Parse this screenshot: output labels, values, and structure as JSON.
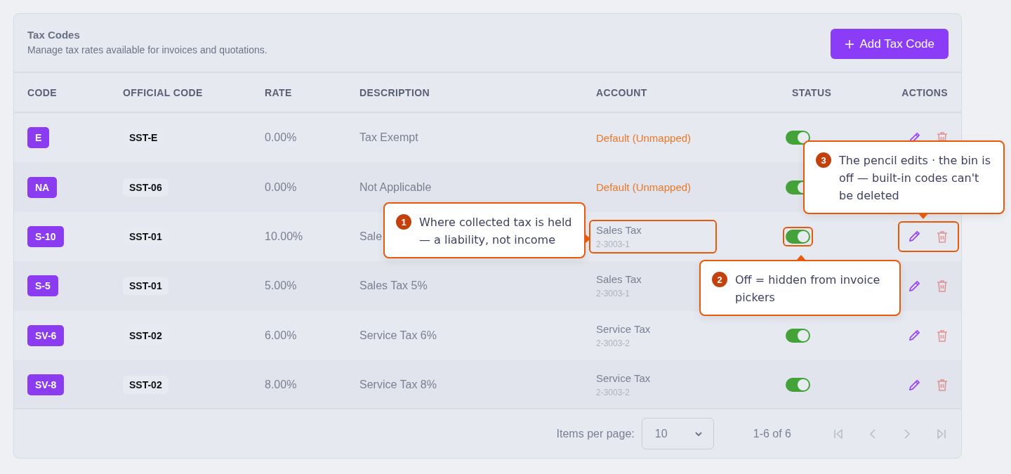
{
  "header": {
    "title": "Tax Codes",
    "subtitle": "Manage tax rates available for invoices and quotations.",
    "add_button": "Add Tax Code"
  },
  "table": {
    "columns": [
      "CODE",
      "OFFICIAL CODE",
      "RATE",
      "DESCRIPTION",
      "ACCOUNT",
      "STATUS",
      "ACTIONS"
    ],
    "rows": [
      {
        "code": "E",
        "official_code": "SST-E",
        "rate": "0.00%",
        "description": "Tax Exempt",
        "account": {
          "kind": "default",
          "name": "Default (Unmapped)",
          "highlighted": false
        },
        "status": {
          "on": true,
          "highlighted": false
        },
        "actions": {
          "highlighted": false,
          "items": [
            {
              "kind": "edit",
              "disabled": false
            },
            {
              "kind": "delete",
              "disabled": true
            }
          ]
        }
      },
      {
        "code": "NA",
        "official_code": "SST-06",
        "rate": "0.00%",
        "description": "Not Applicable",
        "account": {
          "kind": "default",
          "name": "Default (Unmapped)",
          "highlighted": false
        },
        "status": {
          "on": true,
          "highlighted": false
        }
      },
      {
        "code": "S-10",
        "official_code": "SST-01",
        "rate": "10.00%",
        "description": "Sale",
        "account": {
          "kind": "mapped",
          "name": "Sales Tax",
          "number": "2-3003-1",
          "highlighted": true
        },
        "status": {
          "on": true,
          "highlighted": true
        },
        "actions": {
          "highlighted": true,
          "items": [
            {
              "kind": "edit",
              "disabled": false
            },
            {
              "kind": "delete",
              "disabled": true
            }
          ]
        }
      },
      {
        "code": "S-5",
        "official_code": "SST-01",
        "rate": "5.00%",
        "description": "Sales Tax 5%",
        "account": {
          "kind": "mapped",
          "name": "Sales Tax",
          "number": "2-3003-1",
          "highlighted": false
        },
        "actions": {
          "highlighted": false,
          "items": [
            {
              "kind": "edit",
              "disabled": false
            },
            {
              "kind": "delete",
              "disabled": true
            }
          ]
        }
      },
      {
        "code": "SV-6",
        "official_code": "SST-02",
        "rate": "6.00%",
        "description": "Service Tax 6%",
        "account": {
          "kind": "mapped",
          "name": "Service Tax",
          "number": "2-3003-2",
          "highlighted": false
        },
        "status": {
          "on": true,
          "highlighted": false
        },
        "actions": {
          "highlighted": false,
          "items": [
            {
              "kind": "edit",
              "disabled": false
            },
            {
              "kind": "delete",
              "disabled": true
            }
          ]
        }
      },
      {
        "code": "SV-8",
        "official_code": "SST-02",
        "rate": "8.00%",
        "description": "Service Tax 8%",
        "account": {
          "kind": "mapped",
          "name": "Service Tax",
          "number": "2-3003-2",
          "highlighted": false
        },
        "status": {
          "on": true,
          "highlighted": false
        },
        "actions": {
          "highlighted": false,
          "items": [
            {
              "kind": "edit",
              "disabled": false
            },
            {
              "kind": "delete",
              "disabled": true
            }
          ]
        }
      }
    ]
  },
  "pagination": {
    "label": "Items per page:",
    "page_size": "10",
    "range": "1-6 of 6",
    "buttons": [
      {
        "kind": "first",
        "disabled": true
      },
      {
        "kind": "prev",
        "disabled": true
      },
      {
        "kind": "next",
        "disabled": true
      },
      {
        "kind": "last",
        "disabled": true
      }
    ]
  },
  "callouts": [
    {
      "number": "1",
      "text": "Where collected tax is held — a liability, not income",
      "kind": "right"
    },
    {
      "number": "2",
      "text": "Off = hidden from invoice pickers",
      "kind": "up"
    },
    {
      "number": "3",
      "text": "The pencil edits · the bin is off — built-in codes can't be deleted",
      "kind": "down"
    }
  ]
}
